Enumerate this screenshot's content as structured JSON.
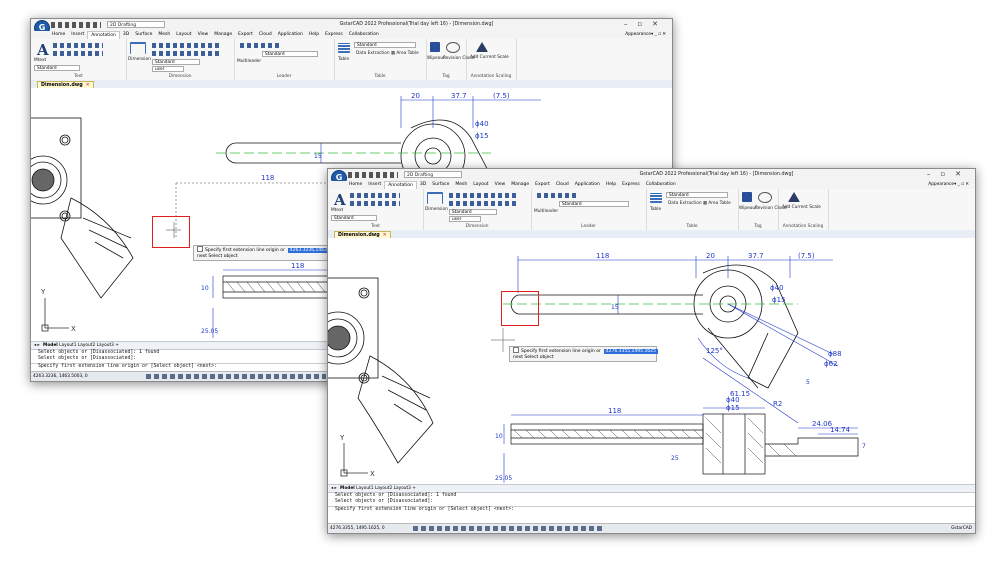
{
  "windows": [
    {
      "id": "back",
      "title": "GstarCAD 2022 Professional(Trial day left 16) - [Dimension.dwg]",
      "workspace": "2D Drafting",
      "menu": [
        "Home",
        "Insert",
        "Annotation",
        "3D",
        "Surface",
        "Mesh",
        "Layout",
        "View",
        "Manage",
        "Export",
        "Cloud",
        "Application",
        "Help",
        "Express",
        "Collaboration"
      ],
      "active_menu": "Annotation",
      "appearance": "Appearance",
      "ribbon": {
        "text_style": "Standard",
        "dim_style": "Standard",
        "user_layer": "user",
        "multileader_label": "Multileader",
        "table_style": "Standard",
        "data_extraction": "Data Extraction",
        "area_table": "Area Table",
        "wipeout": "Wipeout",
        "revision_cloud": "Revision Cloud",
        "add_current_scale": "Add Current Scale",
        "mtext": "Mtext",
        "dimension": "Dimension",
        "table": "Table",
        "panels": [
          "Text",
          "Dimension",
          "Leader",
          "Table",
          "Tag",
          "Annotation Scaling"
        ]
      },
      "doc_tab": "Dimension.dwg",
      "dims": [
        "20",
        "37.7",
        "(7.5)",
        "ϕ40",
        "ϕ15",
        "15",
        "118",
        "10",
        "25.05"
      ],
      "prompt": {
        "label": "Specify first extension line origin or",
        "value": "4263.3236,1463.5003",
        "option": "next Select object"
      },
      "layout_tabs": [
        "Model",
        "Layout1",
        "Layout2",
        "Layout3",
        "+"
      ],
      "cmd_lines": [
        "Select objects or [Disassociated]: 1 found",
        "Select objects or [Disassociated]:",
        "Specify first extension line origin or [Select object] <next>:"
      ],
      "coords": "4263.3236, 1463.5003, 0"
    },
    {
      "id": "front",
      "title": "GstarCAD 2022 Professional(Trial day left 16) - [Dimension.dwg]",
      "workspace": "2D Drafting",
      "menu": [
        "Home",
        "Insert",
        "Annotation",
        "3D",
        "Surface",
        "Mesh",
        "Layout",
        "View",
        "Manage",
        "Export",
        "Cloud",
        "Application",
        "Help",
        "Express",
        "Collaboration"
      ],
      "active_menu": "Annotation",
      "appearance": "Appearance",
      "ribbon": {
        "text_style": "Standard",
        "dim_style": "Standard",
        "user_layer": "user",
        "multileader_label": "Multileader",
        "table_style": "Standard",
        "data_extraction": "Data Extraction",
        "area_table": "Area Table",
        "wipeout": "Wipeout",
        "revision_cloud": "Revision Cloud",
        "add_current_scale": "Add Current Scale",
        "mtext": "Mtext",
        "dimension": "Dimension",
        "table": "Table",
        "panels": [
          "Text",
          "Dimension",
          "Leader",
          "Table",
          "Tag",
          "Annotation Scaling"
        ]
      },
      "doc_tab": "Dimension.dwg",
      "dims": [
        "118",
        "20",
        "37.7",
        "(7.5)",
        "ϕ40",
        "ϕ15",
        "15",
        "125°",
        "ϕ88",
        "ϕ62",
        "61.15",
        "5",
        "118",
        "10",
        "25.05",
        "25",
        "ϕ40",
        "ϕ15",
        "R2",
        "24.06",
        "14.74",
        "7"
      ],
      "prompt": {
        "label": "Specify first extension line origin or",
        "value": "4276.3355,1495.1625",
        "option": "next Select object"
      },
      "layout_tabs": [
        "Model",
        "Layout1",
        "Layout2",
        "Layout3",
        "+"
      ],
      "cmd_lines": [
        "Select objects or [Disassociated]: 1 found",
        "Select objects or [Disassociated]:",
        "Specify first extension line origin or [Select object] <next>:"
      ],
      "coords": "4276.3355, 1495.1625, 0",
      "status_right": "GstarCAD"
    }
  ],
  "colors": {
    "accent": "#2f6fdc",
    "highlight": "#e02020",
    "centerline": "#3bbf3b",
    "dim": "#1f37c8"
  }
}
